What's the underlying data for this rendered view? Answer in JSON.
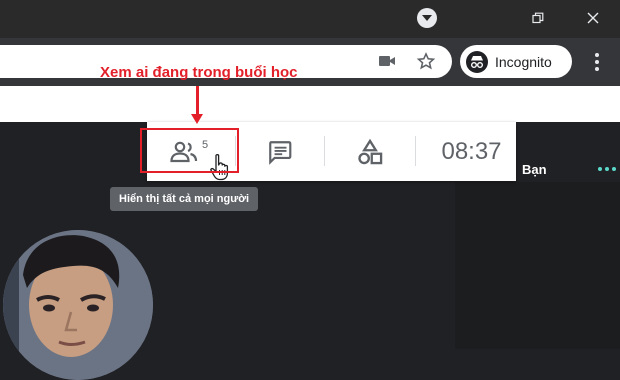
{
  "browser": {
    "incognito_label": "Incognito"
  },
  "annotation": {
    "caption": "Xem ai đang trong buổi học",
    "highlight_color": "#e3202a"
  },
  "meet_bar": {
    "participant_count": "5",
    "clock": "08:37",
    "icons": [
      "people-icon",
      "chat-icon",
      "activities-icon"
    ]
  },
  "tooltip": {
    "text": "Hiển thị tất cả mọi người"
  },
  "side_panel": {
    "you_label": "Bạn"
  },
  "colors": {
    "accent": "#e3202a",
    "bar_bg": "#ffffff",
    "page_dark": "#202124",
    "icon_gray": "#5f6368",
    "teal_dots": "#5ad8c9"
  }
}
